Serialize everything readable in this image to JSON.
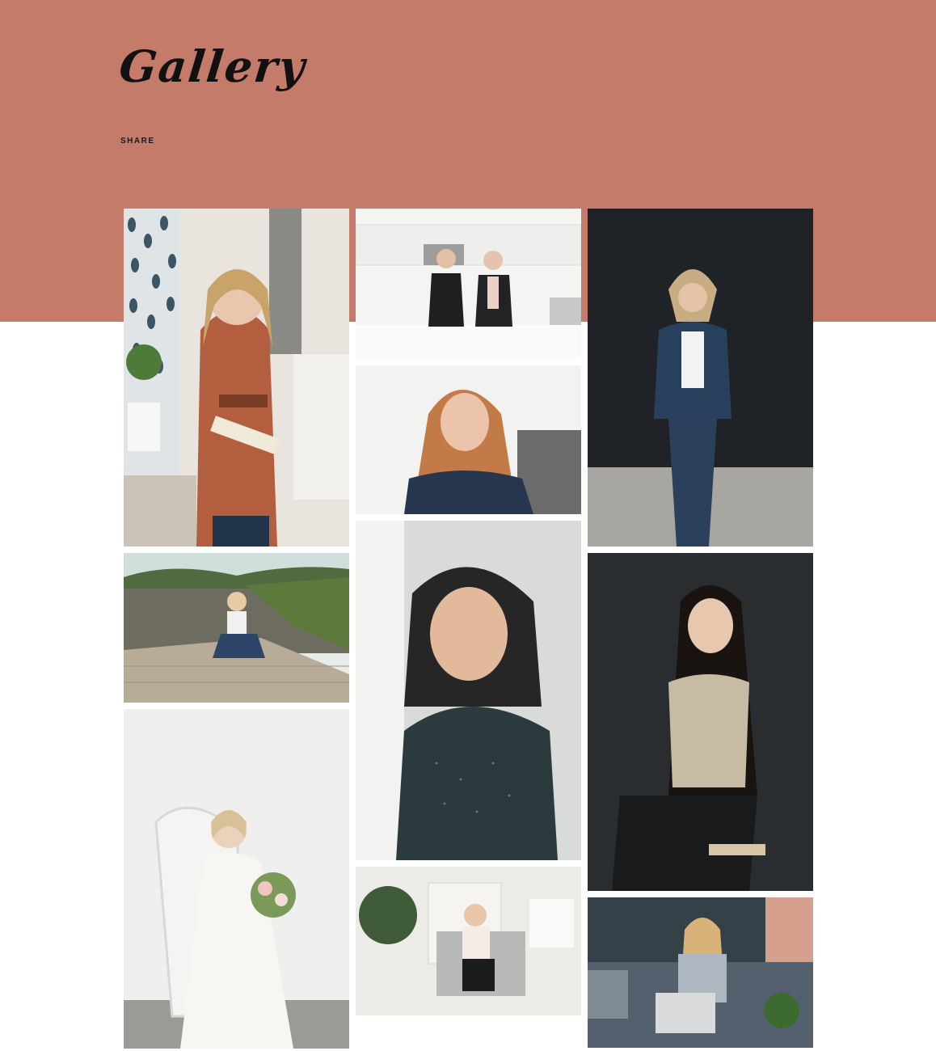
{
  "header": {
    "title": "Gallery",
    "share_label": "SHARE",
    "background_color": "#c57b6a"
  },
  "gallery": {
    "columns": 3,
    "photos": [
      {
        "id": "woman-rust-jacket-office"
      },
      {
        "id": "two-women-kitchen"
      },
      {
        "id": "woman-navy-suit-dark-backdrop"
      },
      {
        "id": "redhead-denim-jacket"
      },
      {
        "id": "woman-on-lake-dock"
      },
      {
        "id": "dark-hair-woman-smiling-window"
      },
      {
        "id": "long-dark-hair-woman-stool"
      },
      {
        "id": "bride-wicker-chair"
      },
      {
        "id": "woman-armchair-living-room"
      },
      {
        "id": "woman-laptop-sofa"
      }
    ]
  }
}
